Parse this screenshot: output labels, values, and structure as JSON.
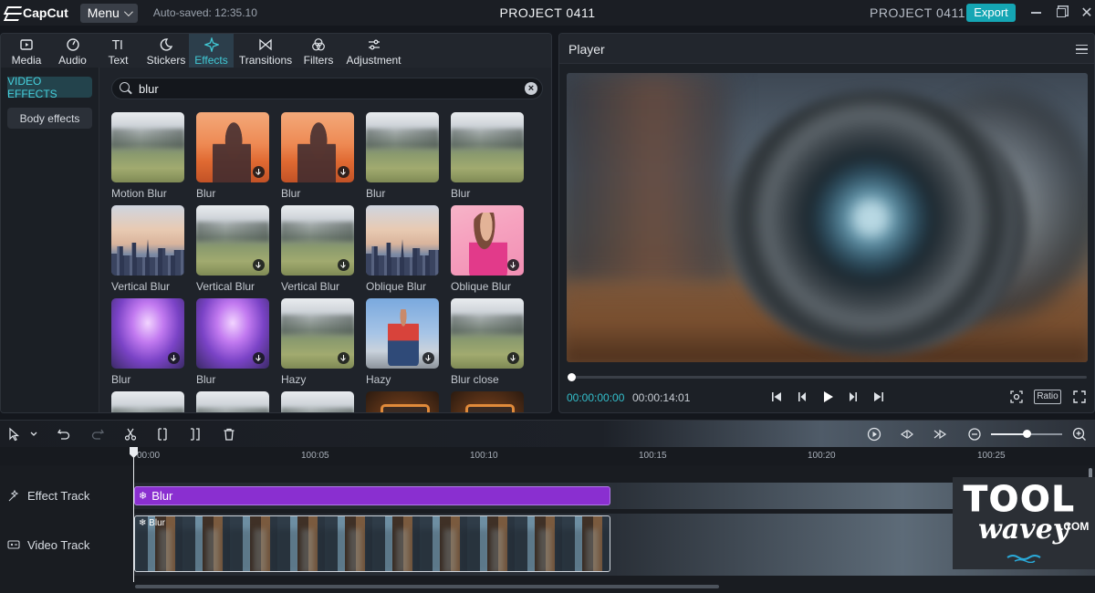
{
  "app": {
    "logo_text": "CapCut",
    "menu_label": "Menu",
    "autosave": "Auto-saved: 12:35.10",
    "title_center": "PROJECT 0411",
    "title_right": "PROJECT 0411",
    "export_label": "Export",
    "accent": "#15a6b4"
  },
  "tabs": [
    {
      "label": "Media",
      "icon": "media-icon"
    },
    {
      "label": "Audio",
      "icon": "audio-icon"
    },
    {
      "label": "Text",
      "icon": "text-icon"
    },
    {
      "label": "Stickers",
      "icon": "stickers-icon"
    },
    {
      "label": "Effects",
      "icon": "effects-icon",
      "active": true
    },
    {
      "label": "Transitions",
      "icon": "transitions-icon"
    },
    {
      "label": "Filters",
      "icon": "filters-icon"
    },
    {
      "label": "Adjustment",
      "icon": "adjustment-icon"
    }
  ],
  "side_nav": {
    "video_effects": "VIDEO EFFECTS",
    "body_effects": "Body effects"
  },
  "search": {
    "query": "blur"
  },
  "effects": [
    {
      "label": "Motion Blur",
      "thumb": "meadow",
      "download": false
    },
    {
      "label": "Blur",
      "thumb": "sunset",
      "download": true
    },
    {
      "label": "Blur",
      "thumb": "sunset",
      "download": true
    },
    {
      "label": "Blur",
      "thumb": "meadow",
      "download": false
    },
    {
      "label": "Blur",
      "thumb": "meadow",
      "download": false
    },
    {
      "label": "Vertical Blur",
      "thumb": "city",
      "download": true
    },
    {
      "label": "Vertical Blur",
      "thumb": "meadow",
      "download": true
    },
    {
      "label": "Vertical Blur",
      "thumb": "meadow",
      "download": true
    },
    {
      "label": "Oblique Blur",
      "thumb": "city",
      "download": true
    },
    {
      "label": "Oblique Blur",
      "thumb": "woman",
      "download": true
    },
    {
      "label": "Blur",
      "thumb": "purple",
      "download": true
    },
    {
      "label": "Blur",
      "thumb": "purple",
      "download": true
    },
    {
      "label": "Hazy",
      "thumb": "meadow",
      "download": true
    },
    {
      "label": "Hazy",
      "thumb": "man",
      "download": true
    },
    {
      "label": "Blur close",
      "thumb": "meadow",
      "download": true
    },
    {
      "label": "",
      "thumb": "meadow",
      "download": false
    },
    {
      "label": "",
      "thumb": "meadow",
      "download": false
    },
    {
      "label": "",
      "thumb": "meadow",
      "download": false
    },
    {
      "label": "",
      "thumb": "tv",
      "download": false
    },
    {
      "label": "",
      "thumb": "tv",
      "download": false
    }
  ],
  "player": {
    "title": "Player",
    "current_time": "00:00:00:00",
    "total_time": "00:00:14:01",
    "ratio_label": "Ratio",
    "progress": 0.0
  },
  "timeline": {
    "ruler_labels": [
      "00:00",
      "100:05",
      "100:10",
      "100:15",
      "100:20",
      "100:25"
    ],
    "zoom_level": 0.5,
    "tracks": [
      {
        "label": "Effect Track",
        "icon": "effect-track-icon"
      },
      {
        "label": "Video Track",
        "icon": "video-track-icon"
      }
    ],
    "effect_clip_label": "Blur",
    "video_clip_label": "Blur",
    "effect_clip_color": "#8a2fd0"
  },
  "watermark": {
    "line1": "TOOL",
    "line2": "wavey",
    "suffix": ".COM"
  }
}
